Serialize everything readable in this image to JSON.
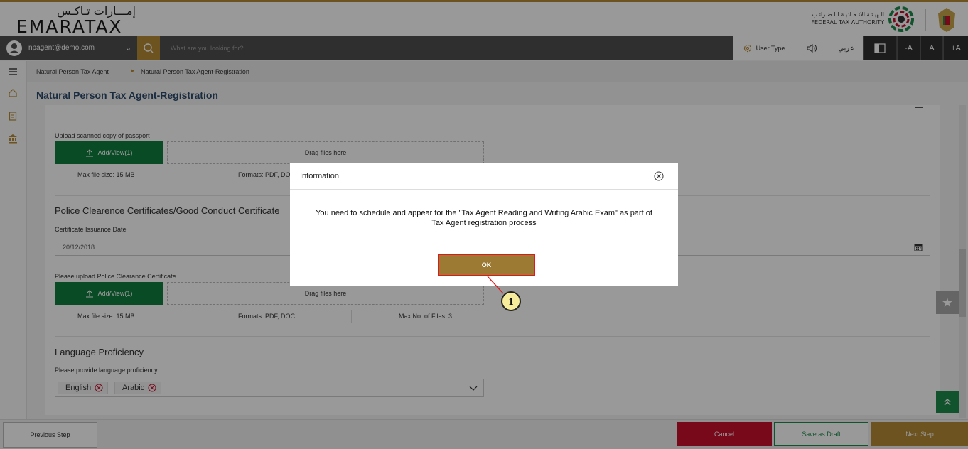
{
  "header": {
    "logo_ar": "إمـــارات تـاكـس",
    "logo_en": "EMARATAX",
    "fta_ar": "الـهيـئـة الاتـحـاديـة لـلـضـرائـب",
    "fta_en": "FEDERAL TAX AUTHORITY"
  },
  "navbar": {
    "user_email": "npagent@demo.com",
    "search_placeholder": "What are you looking for?",
    "user_type_label": "User Type",
    "arabic_label": "عربي",
    "font_decrease": "-A",
    "font_normal": "A",
    "font_increase": "+A"
  },
  "breadcrumb": {
    "parent": "Natural Person Tax Agent",
    "separator": "►",
    "current": "Natural Person Tax Agent-Registration"
  },
  "page": {
    "title": "Natural Person Tax Agent-Registration"
  },
  "passport": {
    "label": "Upload scanned copy of passport",
    "button": "Add/View(1)",
    "dropzone": "Drag files here",
    "max_size": "Max file size: 15 MB",
    "formats": "Formats: PDF, DOC"
  },
  "police": {
    "section_title": "Police Clearence Certificates/Good Conduct Certificate",
    "date_label": "Certificate Issuance Date",
    "date_value": "20/12/2018",
    "upload_label": "Please upload Police Clearance Certificate",
    "button": "Add/View(1)",
    "dropzone": "Drag files here",
    "max_size": "Max file size: 15 MB",
    "formats": "Formats: PDF, DOC",
    "max_files": "Max No. of Files: 3"
  },
  "language": {
    "section_title": "Language Proficiency",
    "label": "Please provide language proficiency",
    "chips": [
      "English",
      "Arabic"
    ]
  },
  "footer": {
    "previous": "Previous Step",
    "cancel": "Cancel",
    "save_draft": "Save as Draft",
    "next": "Next Step"
  },
  "modal": {
    "title": "Information",
    "message": "You need to schedule and appear for the \"Tax Agent Reading and Writing Arabic Exam\" as part of Tax Agent registration process",
    "ok": "OK"
  },
  "callout": {
    "number": "1"
  },
  "colors": {
    "gold": "#b68a35",
    "green": "#107e3e",
    "red": "#c8102e",
    "navy_title": "#2d4a6b"
  }
}
